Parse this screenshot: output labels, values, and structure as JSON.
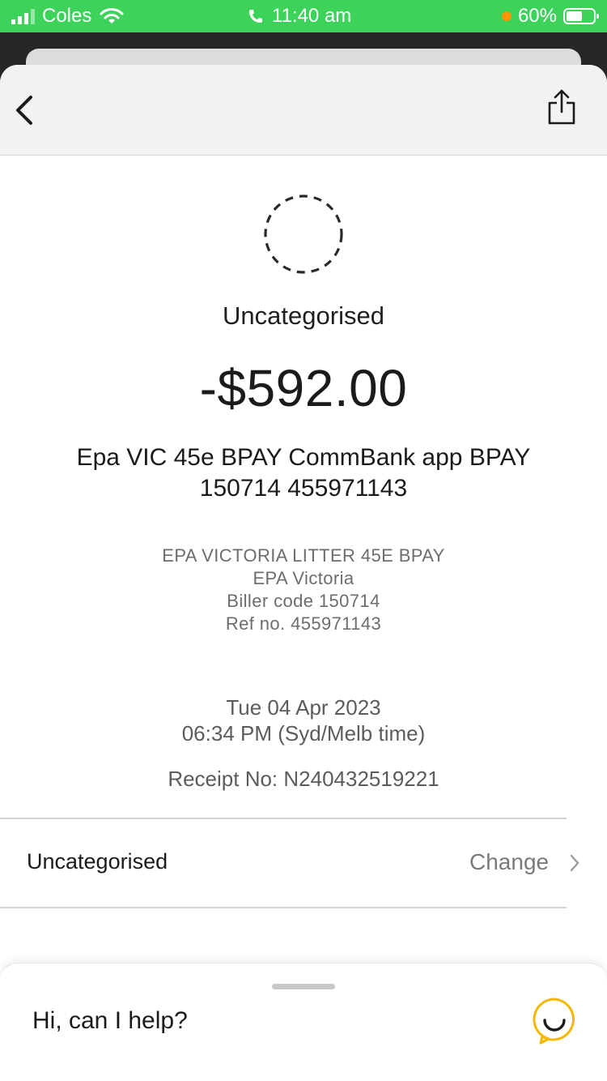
{
  "status_bar": {
    "carrier": "Coles",
    "time": "11:40 am",
    "battery": "60%",
    "battery_level": 0.6,
    "icons": [
      "signal-icon",
      "wifi-icon",
      "phone-icon",
      "battery-icon"
    ]
  },
  "nav": {
    "back_icon": "chevron-left-icon",
    "share_icon": "share-icon"
  },
  "transaction": {
    "category_icon": "dashed-circle-icon",
    "category": "Uncategorised",
    "amount": "-$592.00",
    "description_line1": "Epa VIC 45e BPAY CommBank app BPAY",
    "description_line2": "150714 455971143",
    "biller_name": "EPA VICTORIA LITTER 45E BPAY",
    "biller_org": "EPA Victoria",
    "biller_code": "Biller code 150714",
    "ref_no": "Ref no. 455971143",
    "date": "Tue 04 Apr 2023",
    "time": "06:34 PM (Syd/Melb time)",
    "receipt": "Receipt No: N240432519221"
  },
  "category_row": {
    "label": "Uncategorised",
    "action": "Change"
  },
  "help": {
    "text": "Hi, can I help?",
    "icon": "ceba-chat-icon"
  },
  "colors": {
    "status_bar": "#3dd35a",
    "accent_yellow": "#f5b800",
    "dark_band": "#262626"
  }
}
